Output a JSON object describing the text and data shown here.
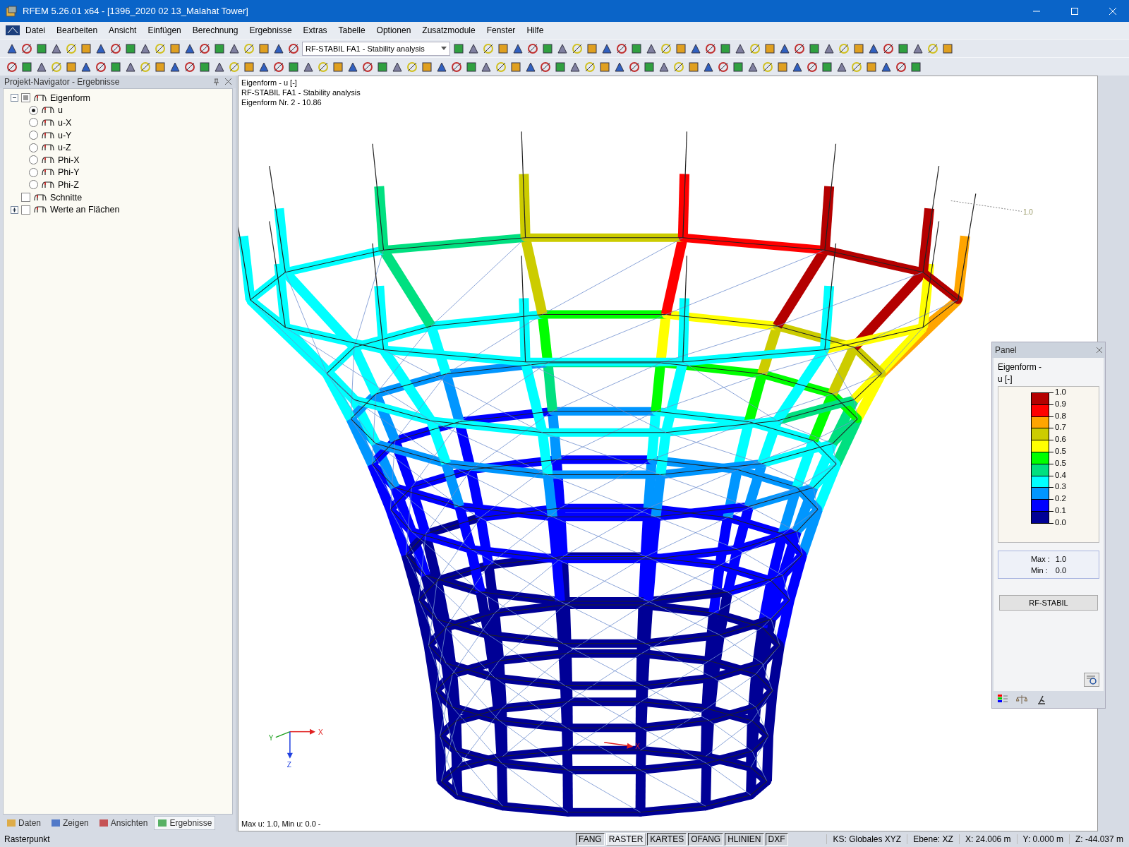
{
  "window": {
    "title": "RFEM 5.26.01 x64 - [1396_2020 02 13_Malahat Tower]"
  },
  "menu": [
    "Datei",
    "Bearbeiten",
    "Ansicht",
    "Einfügen",
    "Berechnung",
    "Ergebnisse",
    "Extras",
    "Tabelle",
    "Optionen",
    "Zusatzmodule",
    "Fenster",
    "Hilfe"
  ],
  "toolbar": {
    "case_select": "RF-STABIL FA1 - Stability analysis"
  },
  "navigator": {
    "title": "Projekt-Navigator - Ergebnisse",
    "tree": [
      {
        "label": "Eigenform",
        "checked": true,
        "expanded": true,
        "children": [
          {
            "label": "u",
            "selected": true
          },
          {
            "label": "u-X",
            "selected": false
          },
          {
            "label": "u-Y",
            "selected": false
          },
          {
            "label": "u-Z",
            "selected": false
          },
          {
            "label": "Phi-X",
            "selected": false
          },
          {
            "label": "Phi-Y",
            "selected": false
          },
          {
            "label": "Phi-Z",
            "selected": false
          }
        ]
      },
      {
        "label": "Schnitte",
        "checked": false
      },
      {
        "label": "Werte an Flächen",
        "checked": false,
        "expanded": false
      }
    ],
    "tabs": [
      {
        "label": "Daten",
        "selected": false
      },
      {
        "label": "Zeigen",
        "selected": false
      },
      {
        "label": "Ansichten",
        "selected": false
      },
      {
        "label": "Ergebnisse",
        "selected": true
      }
    ]
  },
  "view": {
    "header": [
      "Eigenform - u [-]",
      "RF-STABIL FA1 - Stability analysis",
      "Eigenform Nr. 2  -  10.86"
    ],
    "max_marker": "1.0",
    "axes": {
      "x": "X",
      "y": "Y",
      "z": "Z"
    },
    "origin_x": "X",
    "footer": "Max u: 1.0, Min u: 0.0 -"
  },
  "panel": {
    "title": "Panel",
    "label_1": "Eigenform -",
    "label_2": "u [-]",
    "legend": [
      {
        "label": "1.0",
        "color": "#b40000"
      },
      {
        "label": "0.9",
        "color": "#ff0000"
      },
      {
        "label": "0.8",
        "color": "#ffa500"
      },
      {
        "label": "0.7",
        "color": "#cccc00"
      },
      {
        "label": "0.6",
        "color": "#ffff00"
      },
      {
        "label": "0.5",
        "color": "#00ff00"
      },
      {
        "label": "0.5",
        "color": "#00e080"
      },
      {
        "label": "0.4",
        "color": "#00ffff"
      },
      {
        "label": "0.3",
        "color": "#0096ff"
      },
      {
        "label": "0.2",
        "color": "#0000ff"
      },
      {
        "label": "0.1",
        "color": "#000096"
      },
      {
        "label": "0.0"
      }
    ],
    "max_label": "Max  :",
    "max_value": "1.0",
    "min_label": "Min  :",
    "min_value": "0.0",
    "button": "RF-STABIL"
  },
  "status": {
    "left": "Rasterpunkt",
    "toggles": [
      {
        "label": "FANG",
        "on": true
      },
      {
        "label": "RASTER",
        "on": false
      },
      {
        "label": "KARTES",
        "on": true
      },
      {
        "label": "OFANG",
        "on": true
      },
      {
        "label": "HLINIEN",
        "on": true
      },
      {
        "label": "DXF",
        "on": true
      }
    ],
    "fields": [
      "KS: Globales XYZ",
      "Ebene: XZ",
      "X:  24.006 m",
      "Y:  0.000 m",
      "Z:  -44.037 m"
    ]
  }
}
